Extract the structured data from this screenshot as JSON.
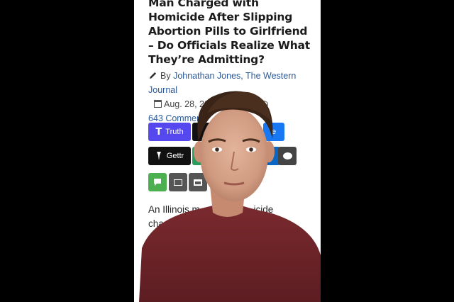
{
  "article": {
    "headline": "Man Charged with Homicide After Slipping Abortion Pills to Girlfriend – Do Officials Realize What They’re Admitting?",
    "by_label": "By",
    "author": "Johnathan Jones, The Western Journal",
    "date": "Aug. 28, 2025 7:00 am",
    "comments": "643 Comments",
    "body_line1": "An Illinois m",
    "body_line1_end": "icide",
    "body_line2": "cha"
  },
  "share": {
    "truth_label": "Truth",
    "truth_logo": "T",
    "fb_label": "e",
    "gettr_label": "Gettr",
    "linkedin_label": "n"
  },
  "overlay": {
    "description": "presenter-video-overlay"
  },
  "colors": {
    "truth": "#5448ee",
    "facebook": "#1877f2",
    "green": "#2a9d5c",
    "sms_green": "#4caf50",
    "author_link": "#2b5a9a"
  },
  "icons": [
    "pen-icon",
    "calendar-icon",
    "comment-icon",
    "truth-social-icon",
    "x-icon",
    "gettr-icon",
    "sms-icon",
    "email-icon",
    "print-icon",
    "chat-bubble-icon"
  ]
}
